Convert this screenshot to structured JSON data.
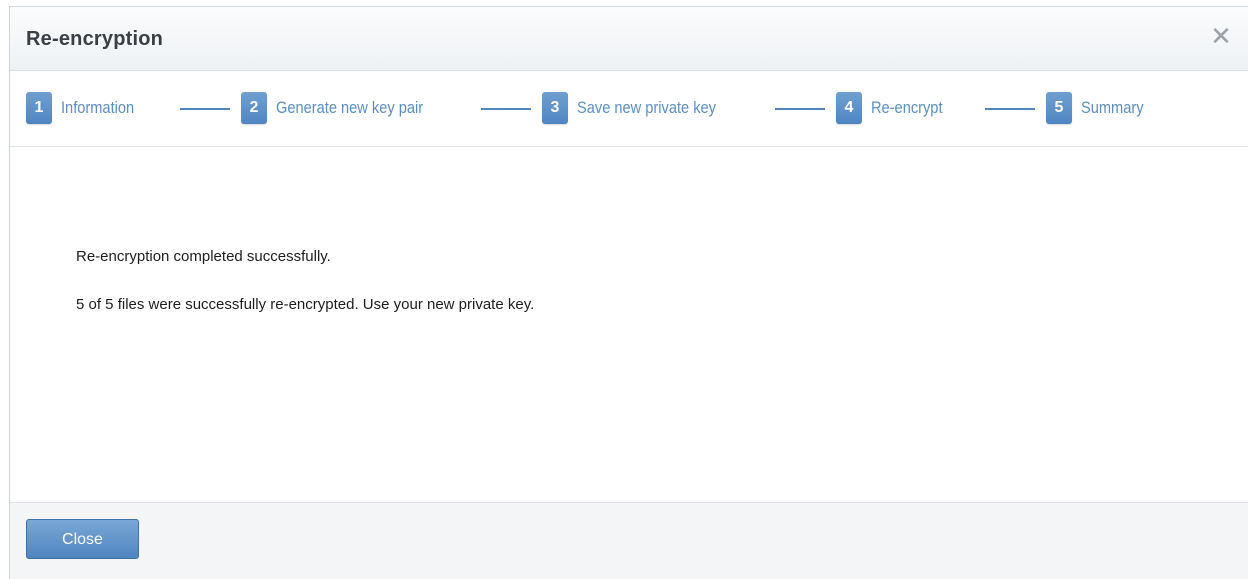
{
  "dialog": {
    "title": "Re-encryption",
    "close_icon": "close-icon"
  },
  "steps": [
    {
      "number": "1",
      "label": "Information"
    },
    {
      "number": "2",
      "label": "Generate new key pair"
    },
    {
      "number": "3",
      "label": "Save new private key"
    },
    {
      "number": "4",
      "label": "Re-encrypt"
    },
    {
      "number": "5",
      "label": "Summary"
    }
  ],
  "content": {
    "line1": "Re-encryption completed successfully.",
    "line2": "5 of 5 files were successfully re-encrypted. Use your new private key."
  },
  "footer": {
    "close_label": "Close"
  },
  "colors": {
    "accent": "#4f86c2",
    "step_text": "#5b8fc4"
  }
}
